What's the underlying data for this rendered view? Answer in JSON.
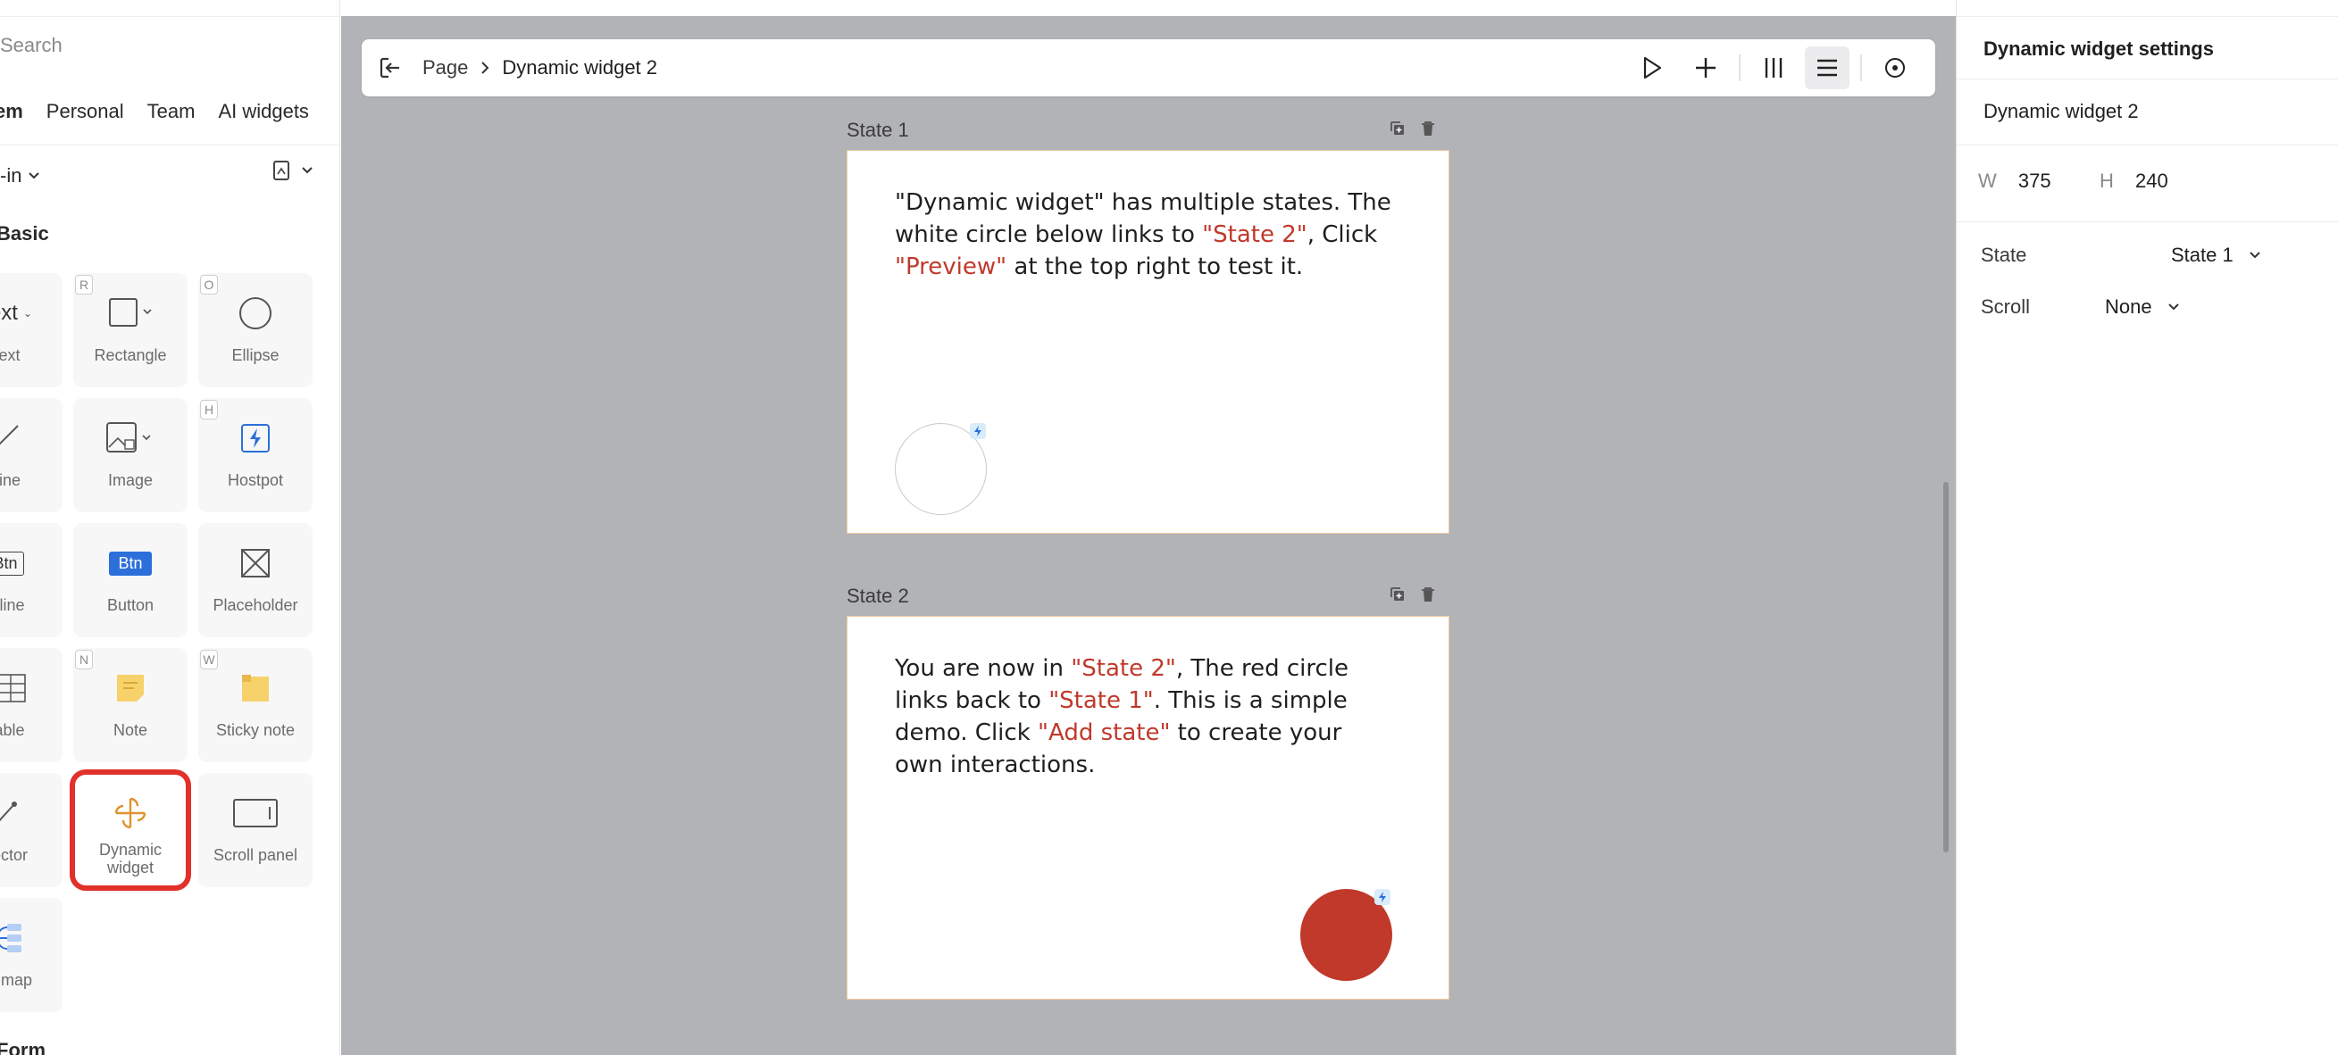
{
  "left_panel": {
    "search_placeholder": "Search",
    "tabs": [
      {
        "label": "em",
        "active": true
      },
      {
        "label": "Personal",
        "active": false
      },
      {
        "label": "Team",
        "active": false
      },
      {
        "label": "AI widgets",
        "active": false
      }
    ],
    "filter_label": "-in",
    "sections": {
      "basic": "Basic",
      "form": "Form"
    },
    "items": [
      {
        "label": "Text",
        "icon": "text-icon",
        "key": ""
      },
      {
        "label": "Rectangle",
        "icon": "rectangle-icon",
        "key": "R"
      },
      {
        "label": "Ellipse",
        "icon": "ellipse-icon",
        "key": "O"
      },
      {
        "label": "Line",
        "icon": "line-icon",
        "key": ""
      },
      {
        "label": "Image",
        "icon": "image-icon",
        "key": ""
      },
      {
        "label": "Hostpot",
        "icon": "hotspot-icon",
        "key": "H"
      },
      {
        "label": "utline",
        "icon": "outline-button-icon",
        "key": "",
        "glyph": "Btn"
      },
      {
        "label": "Button",
        "icon": "button-icon",
        "key": "",
        "glyph": "Btn"
      },
      {
        "label": "Placeholder",
        "icon": "placeholder-icon",
        "key": ""
      },
      {
        "label": "Table",
        "icon": "table-icon",
        "key": ""
      },
      {
        "label": "Note",
        "icon": "note-icon",
        "key": "N"
      },
      {
        "label": "Sticky note",
        "icon": "sticky-note-icon",
        "key": "W"
      },
      {
        "label": "nector",
        "icon": "connector-icon",
        "key": ""
      },
      {
        "label": "Dynamic widget",
        "icon": "dynamic-widget-icon",
        "key": "",
        "selected": true
      },
      {
        "label": "Scroll panel",
        "icon": "scroll-panel-icon",
        "key": ""
      },
      {
        "label": "nd map",
        "icon": "mind-map-icon",
        "key": ""
      }
    ]
  },
  "toolbar": {
    "crumb_page": "Page",
    "crumb_current": "Dynamic widget 2"
  },
  "canvas": {
    "state1": {
      "label": "State 1",
      "text_a": "\"Dynamic widget\" has multiple states. The white circle below links to ",
      "text_b": "\"State 2\"",
      "text_c": ", Click ",
      "text_d": "\"Preview\"",
      "text_e": " at the top right to test it."
    },
    "state2": {
      "label": "State 2",
      "text_a": "You are now in ",
      "text_b": "\"State 2\"",
      "text_c": ", The red circle links back to ",
      "text_d": "\"State 1\"",
      "text_e": ". This is a simple demo. Click ",
      "text_f": "\"Add state\"",
      "text_g": " to create your own interactions."
    },
    "colors": {
      "accent_red": "#c0392b",
      "frame_border": "#f0c89a"
    }
  },
  "right_panel": {
    "title": "Dynamic widget settings",
    "widget_name": "Dynamic widget 2",
    "w_label": "W",
    "w_value": "375",
    "h_label": "H",
    "h_value": "240",
    "state_label": "State",
    "state_value": "State 1",
    "scroll_label": "Scroll",
    "scroll_value": "None"
  }
}
